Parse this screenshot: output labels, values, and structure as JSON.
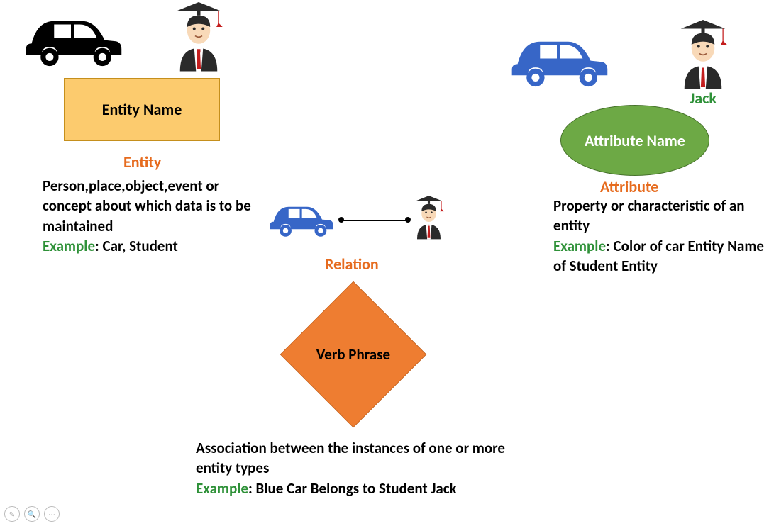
{
  "entity": {
    "box_label": "Entity Name",
    "title": "Entity",
    "desc_line1": "Person,place,object,event or concept about which data is to be maintained",
    "example_word": "Example",
    "example_text": ": Car, Student"
  },
  "relation": {
    "title": "Relation",
    "diamond_label": "Verb Phrase",
    "desc_line1": "Association between the instances of one or more entity types",
    "example_word": "Example",
    "example_text": ": Blue Car Belongs to Student Jack"
  },
  "attribute": {
    "title": "Attribute",
    "ellipse_label": "Attribute Name",
    "jack": "Jack",
    "desc_line1": "Property or characteristic of an entity",
    "example_word": "Example",
    "example_text": ": Color of car Entity Name of Student Entity"
  }
}
